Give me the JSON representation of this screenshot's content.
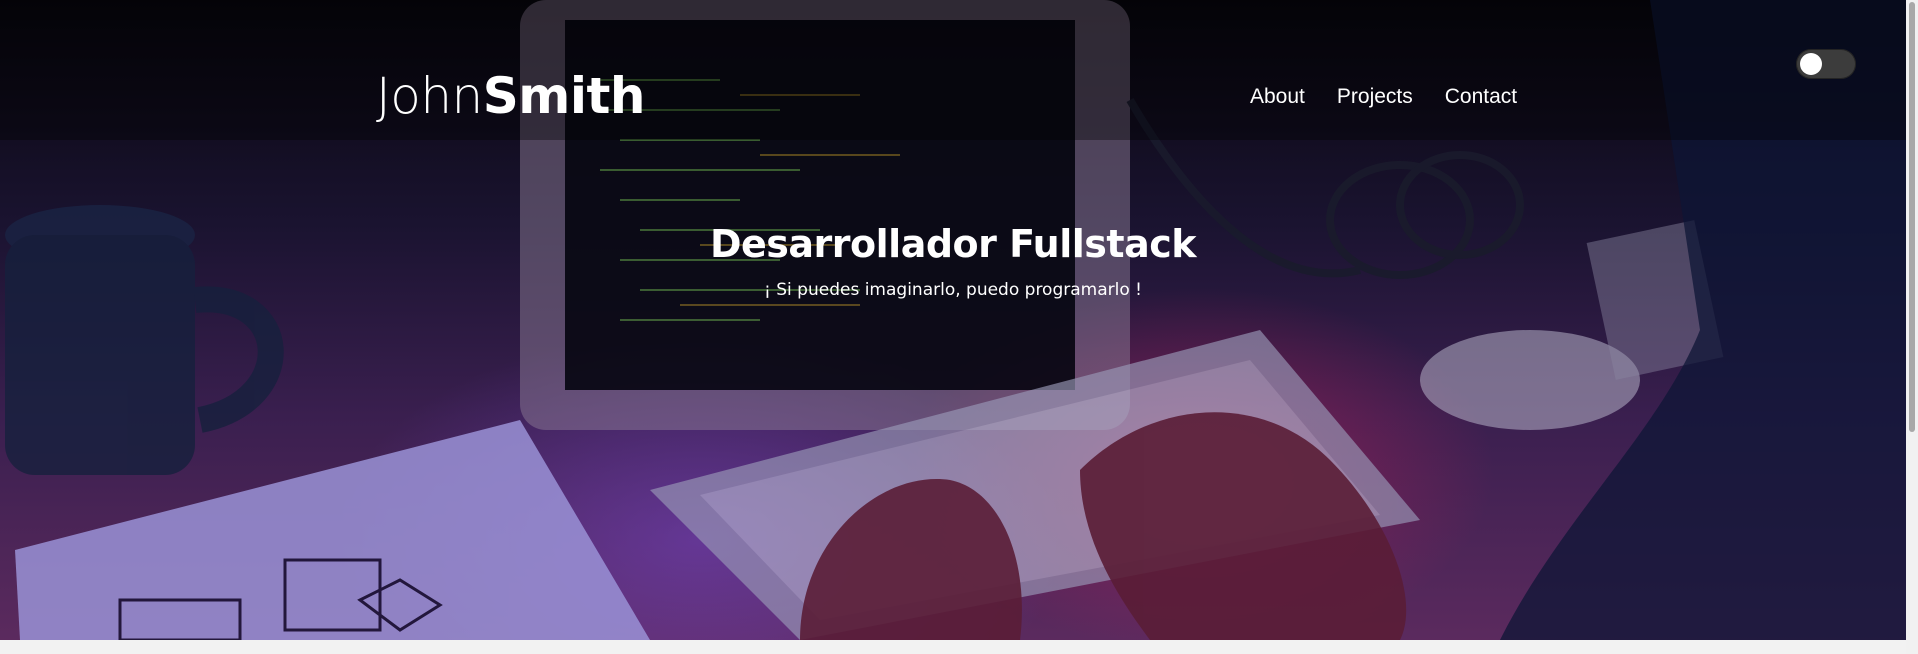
{
  "brand": {
    "first": "John",
    "last": "Smith"
  },
  "nav": {
    "items": [
      {
        "label": "About"
      },
      {
        "label": "Projects"
      },
      {
        "label": "Contact"
      }
    ]
  },
  "theme_toggle": {
    "state": "off",
    "icon": "toggle-switch"
  },
  "hero": {
    "title": "Desarrollador Fullstack",
    "subtitle": "¡ Si puedes imaginarlo, puedo programarlo !"
  },
  "colors": {
    "text": "#ffffff",
    "overlay_dark": "#07060c",
    "accent_magenta": "#c81e5a",
    "accent_purple": "#7846c8",
    "toggle_track": "#3c3c3c",
    "page_background": "#f2f2f2"
  }
}
